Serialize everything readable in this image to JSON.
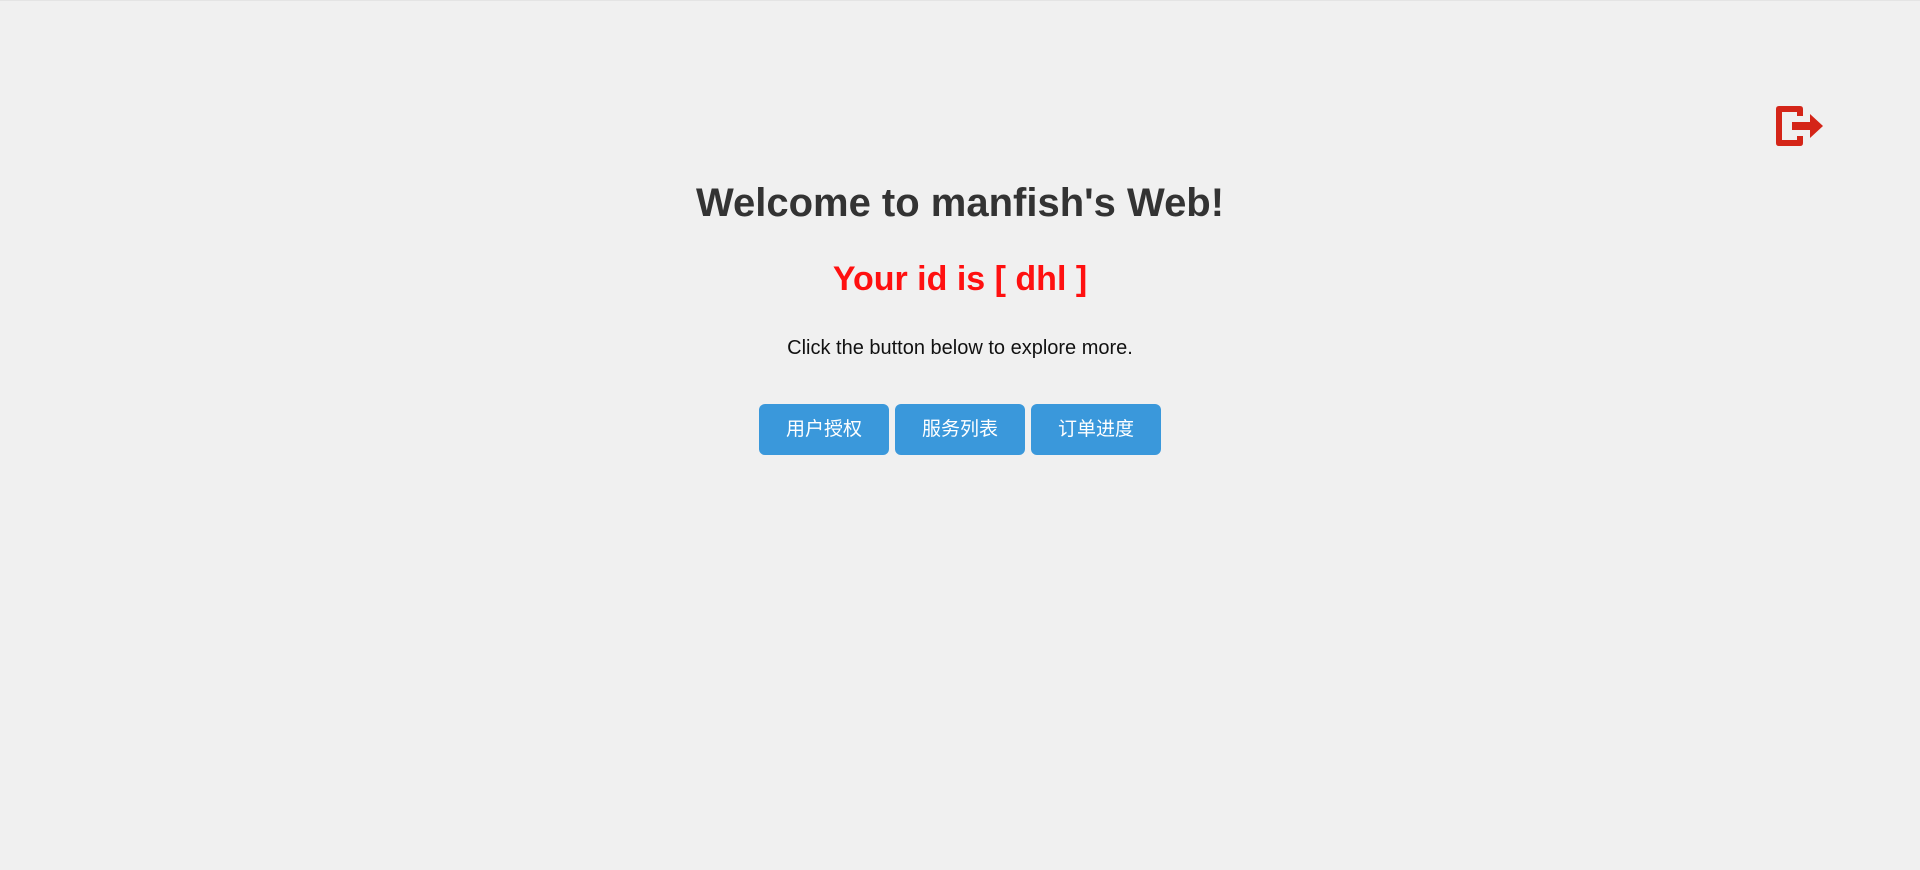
{
  "header": {
    "logout_icon": "logout-icon",
    "logout_color": "#d42518"
  },
  "main": {
    "title": "Welcome to manfish's Web!",
    "user_id_text": "Your id is [ dhl ]",
    "hint": "Click the button below to explore more."
  },
  "buttons": [
    {
      "label": "用户授权"
    },
    {
      "label": "服务列表"
    },
    {
      "label": "订单进度"
    }
  ],
  "colors": {
    "background": "#f0f0f0",
    "title": "#333333",
    "user_id": "#ff1010",
    "button_bg": "#3a98db",
    "button_text": "#ffffff"
  }
}
